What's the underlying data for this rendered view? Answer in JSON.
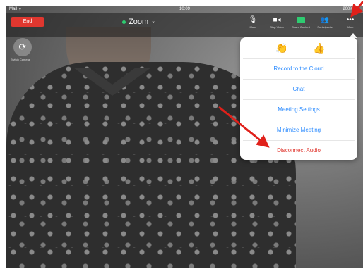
{
  "status": {
    "left": "Mail ᯤ",
    "time": "10:09",
    "right": "200% ▭"
  },
  "toolbar": {
    "end_label": "End",
    "title": "Zoom",
    "mute_label": "Mute",
    "stop_video_label": "Stop Video",
    "share_label": "Share Content",
    "participants_label": "Participants",
    "more_label": "More",
    "mute_icon": "microphone-icon",
    "video_icon": "camera-icon",
    "share_icon": "share-screen-icon",
    "participants_icon": "people-icon",
    "more_icon": "ellipsis-icon"
  },
  "camera": {
    "switch_label": "Switch Camera"
  },
  "menu": {
    "reactions": [
      "👏",
      "👍"
    ],
    "items": [
      {
        "label": "Record to the Cloud"
      },
      {
        "label": "Chat"
      },
      {
        "label": "Meeting Settings"
      },
      {
        "label": "Minimize Meeting"
      },
      {
        "label": "Disconnect Audio"
      }
    ]
  },
  "colors": {
    "end_button": "#e0372f",
    "menu_text": "#2d8cff",
    "danger_text": "#e0372f",
    "annotation_arrow": "#e0201a"
  }
}
